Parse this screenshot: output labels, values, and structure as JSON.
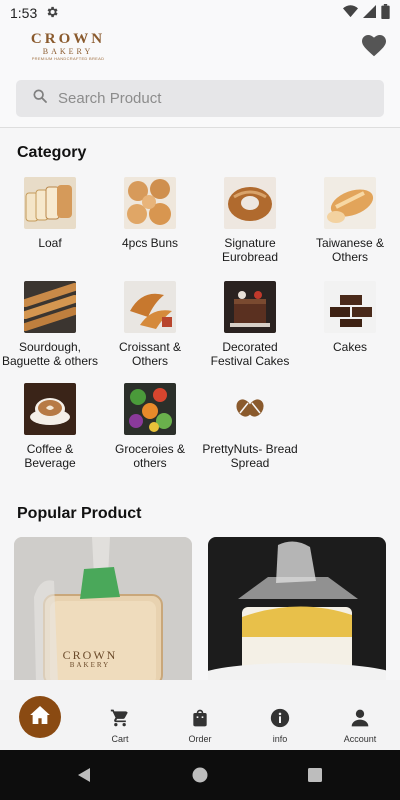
{
  "status_bar": {
    "time": "1:53"
  },
  "header": {
    "logo": {
      "word1": "CROWN",
      "word2": "BAKERY",
      "tagline": "PREMIUM HANDCRAFTED BREAD"
    }
  },
  "search": {
    "placeholder": "Search Product",
    "value": ""
  },
  "category": {
    "title": "Category",
    "items": [
      {
        "label": "Loaf"
      },
      {
        "label": "4pcs Buns"
      },
      {
        "label": "Signature Eurobread"
      },
      {
        "label": "Taiwanese & Others"
      },
      {
        "label": "Sourdough, Baguette & others"
      },
      {
        "label": "Croissant & Others"
      },
      {
        "label": "Decorated Festival Cakes"
      },
      {
        "label": "Cakes"
      },
      {
        "label": "Coffee & Beverage"
      },
      {
        "label": "Groceroies & others"
      },
      {
        "label": "PrettyNuts- Bread Spread"
      }
    ]
  },
  "popular": {
    "title": "Popular Product",
    "card1_logo": {
      "word1": "CROWN",
      "word2": "BAKERY"
    }
  },
  "bottom_nav": {
    "items": [
      {
        "label": "Cart"
      },
      {
        "label": "Order"
      },
      {
        "label": "info"
      },
      {
        "label": "Account"
      }
    ]
  },
  "colors": {
    "brand": "#8a4a12",
    "accent_text": "#8a5a2d"
  }
}
